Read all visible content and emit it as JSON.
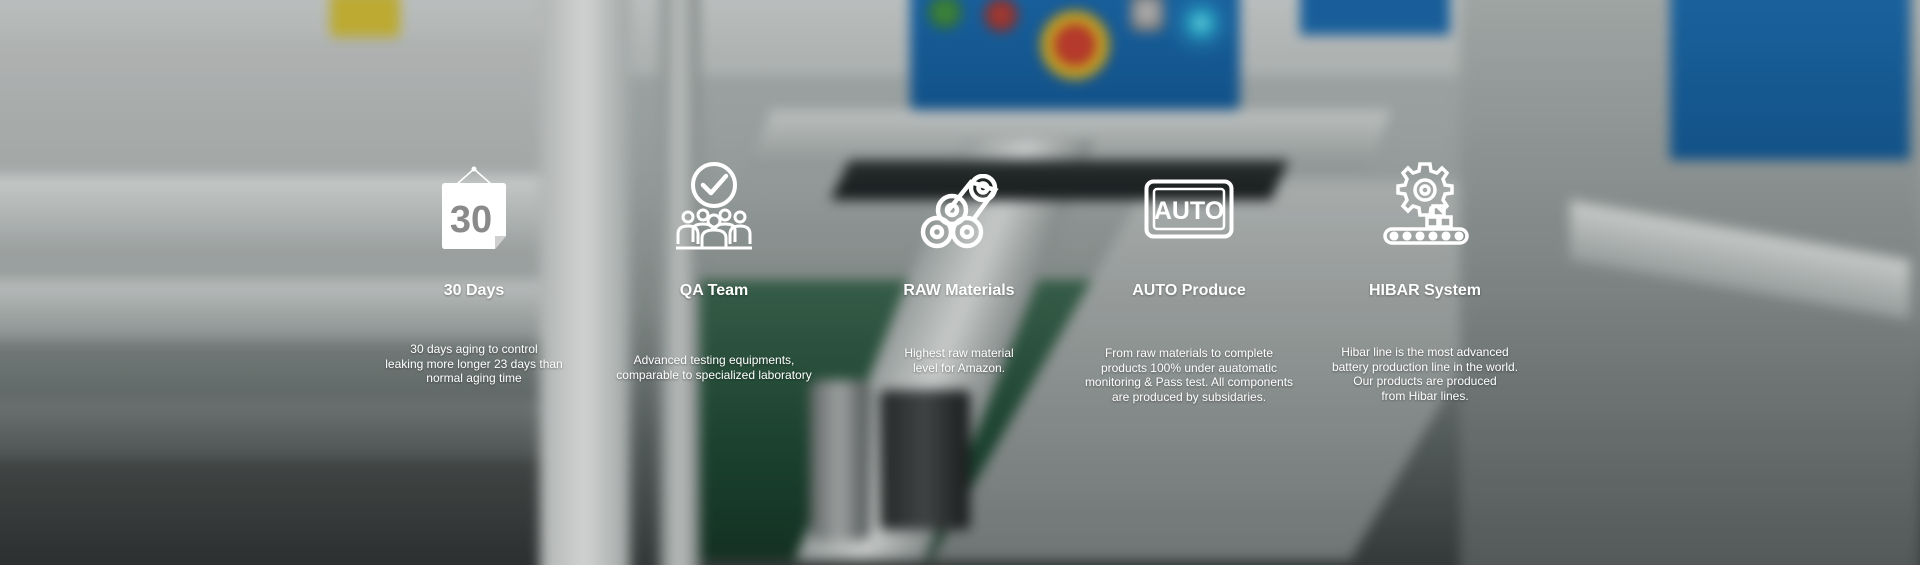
{
  "features": [
    {
      "icon": "calendar-icon",
      "icon_text": "30",
      "title": "30 Days",
      "desc_lines": [
        "30 days aging to control",
        "leaking more longer 23 days than",
        "normal aging time"
      ]
    },
    {
      "icon": "qa-team-icon",
      "title": "QA Team",
      "desc_lines": [
        "Advanced testing equipments,",
        "comparable to specialized laboratory"
      ]
    },
    {
      "icon": "raw-materials-icon",
      "title": "RAW Materials",
      "desc_lines": [
        "Highest raw material",
        "level for Amazon."
      ]
    },
    {
      "icon": "auto-icon",
      "icon_text": "AUTO",
      "title": "AUTO Produce",
      "desc_lines": [
        "From raw materials to complete",
        "products 100% under auatomatic",
        "monitoring & Pass test. All components",
        "are produced by subsidaries."
      ]
    },
    {
      "icon": "production-line-icon",
      "title": "HIBAR System",
      "desc_lines": [
        "Hibar line is the most advanced",
        "battery production line in the world.",
        "Our products are produced",
        "from Hibar lines."
      ]
    }
  ]
}
